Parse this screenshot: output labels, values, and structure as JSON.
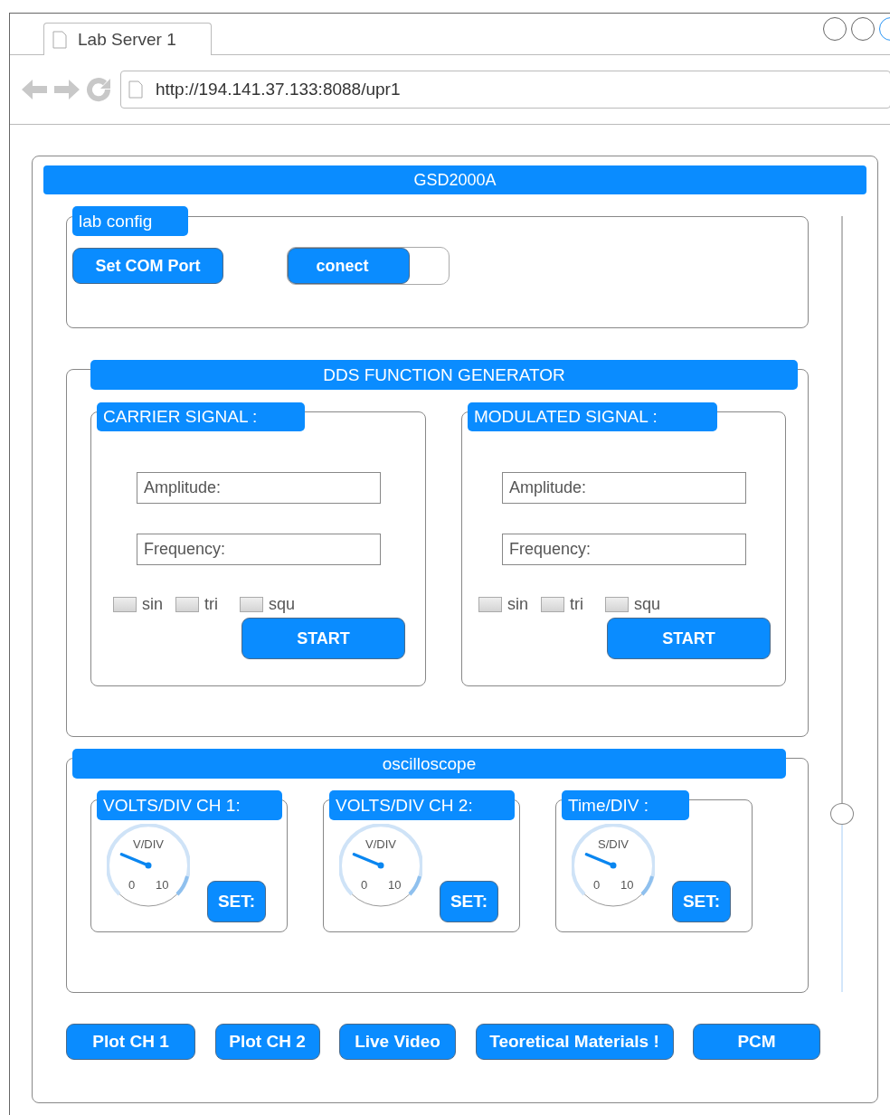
{
  "browser": {
    "tab": {
      "title": "Lab Server 1"
    },
    "address": "http://194.141.37.133:8088/upr1"
  },
  "app": {
    "title": "GSD2000A",
    "lab_config": {
      "title": "lab config",
      "set_com_button": "Set COM Port",
      "connect_toggle": {
        "label": "conect",
        "on": true
      }
    },
    "generator": {
      "title": "DDS FUNCTION GENERATOR",
      "panels": [
        {
          "title": "CARRIER SIGNAL :",
          "fields": [
            {
              "placeholder": "Amplitude:"
            },
            {
              "placeholder": "Frequency:"
            }
          ],
          "waveforms": [
            {
              "label": "sin",
              "checked": false
            },
            {
              "label": "tri",
              "checked": false
            },
            {
              "label": "squ",
              "checked": false
            }
          ],
          "button": "START"
        },
        {
          "title": "MODULATED SIGNAL :",
          "fields": [
            {
              "placeholder": "Amplitude:"
            },
            {
              "placeholder": "Frequency:"
            }
          ],
          "waveforms": [
            {
              "label": "sin",
              "checked": false
            },
            {
              "label": "tri",
              "checked": false
            },
            {
              "label": "squ",
              "checked": false
            }
          ],
          "button": "START"
        }
      ]
    },
    "oscilloscope": {
      "title": "oscilloscope",
      "panels": [
        {
          "title": "VOLTS/DIV CH 1:",
          "gauge": {
            "label": "V/DIV",
            "min": "0",
            "max": "10",
            "level": 0.25
          },
          "button": "SET:"
        },
        {
          "title": "VOLTS/DIV CH 2:",
          "gauge": {
            "label": "V/DIV",
            "min": "0",
            "max": "10",
            "level": 0.25
          },
          "button": "SET:"
        },
        {
          "title": "Time/DIV :",
          "gauge": {
            "label": "S/DIV",
            "min": "0",
            "max": "10",
            "level": 0.25
          },
          "button": "SET:"
        }
      ]
    },
    "slider": {
      "level": 0.23
    },
    "buttons": [
      "Plot CH 1",
      "Plot CH 2",
      "Live Video",
      "Teoretical Materials !",
      "PCM"
    ]
  }
}
